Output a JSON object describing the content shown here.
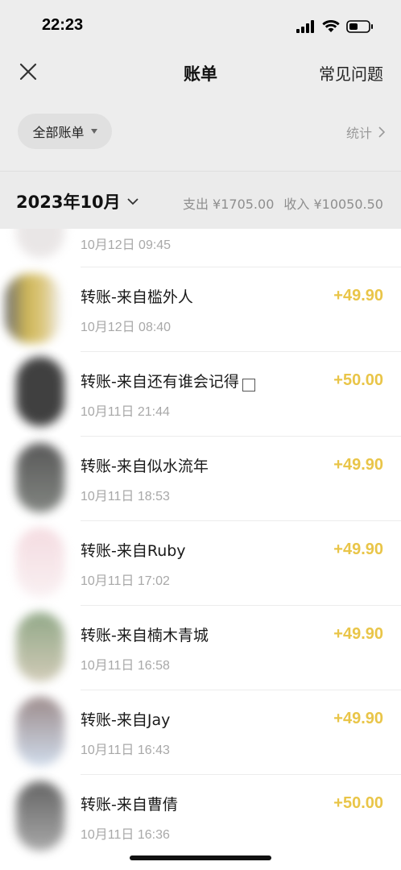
{
  "status_bar": {
    "time": "22:23"
  },
  "nav": {
    "title": "账单",
    "faq": "常见问题"
  },
  "filter": {
    "label": "全部账单",
    "stats": "统计"
  },
  "month": {
    "label": "2023年10月",
    "expense": "支出 ¥1705.00",
    "income": "收入 ¥10050.50"
  },
  "partial_row": {
    "time": "10月12日 09:45"
  },
  "rows": [
    {
      "title": "转账-来自槛外人",
      "time": "10月12日 08:40",
      "amount": "+49.90"
    },
    {
      "title": "转账-来自还有谁会记得",
      "time": "10月11日 21:44",
      "amount": "+50.00"
    },
    {
      "title": "转账-来自似水流年",
      "time": "10月11日 18:53",
      "amount": "+49.90"
    },
    {
      "title": "转账-来自Ruby",
      "time": "10月11日 17:02",
      "amount": "+49.90"
    },
    {
      "title": "转账-来自楠木青城",
      "time": "10月11日 16:58",
      "amount": "+49.90"
    },
    {
      "title": "转账-来自Jay",
      "time": "10月11日 16:43",
      "amount": "+49.90"
    },
    {
      "title": "转账-来自曹倩",
      "time": "10月11日 16:36",
      "amount": "+50.00"
    }
  ],
  "colors": {
    "amount": "#e9c548",
    "background": "#ededed"
  }
}
